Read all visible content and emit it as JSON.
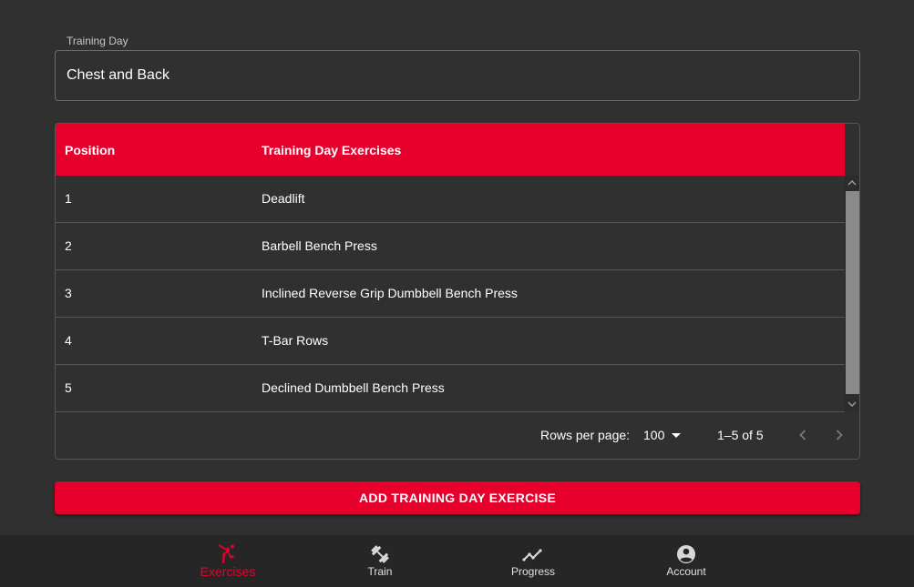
{
  "training_day": {
    "label": "Training Day",
    "value": "Chest and Back"
  },
  "table": {
    "headers": {
      "position": "Position",
      "exercise": "Training Day Exercises"
    },
    "rows": [
      {
        "position": "1",
        "exercise": "Deadlift"
      },
      {
        "position": "2",
        "exercise": "Barbell Bench Press"
      },
      {
        "position": "3",
        "exercise": "Inclined Reverse Grip Dumbbell Bench Press"
      },
      {
        "position": "4",
        "exercise": "T-Bar Rows"
      },
      {
        "position": "5",
        "exercise": "Declined Dumbbell Bench Press"
      }
    ],
    "footer": {
      "rows_per_page_label": "Rows per page:",
      "rows_per_page_value": "100",
      "range": "1–5 of 5"
    }
  },
  "add_button": {
    "label": "ADD TRAINING DAY EXERCISE"
  },
  "bottom_nav": {
    "items": [
      {
        "label": "Exercises",
        "icon": "kick-icon",
        "active": true
      },
      {
        "label": "Train",
        "icon": "dumbbell-icon",
        "active": false
      },
      {
        "label": "Progress",
        "icon": "trend-line-icon",
        "active": false
      },
      {
        "label": "Account",
        "icon": "account-circle-icon",
        "active": false
      }
    ]
  },
  "colors": {
    "accent": "#e8002d",
    "background": "#303030",
    "nav_background": "#262626"
  }
}
